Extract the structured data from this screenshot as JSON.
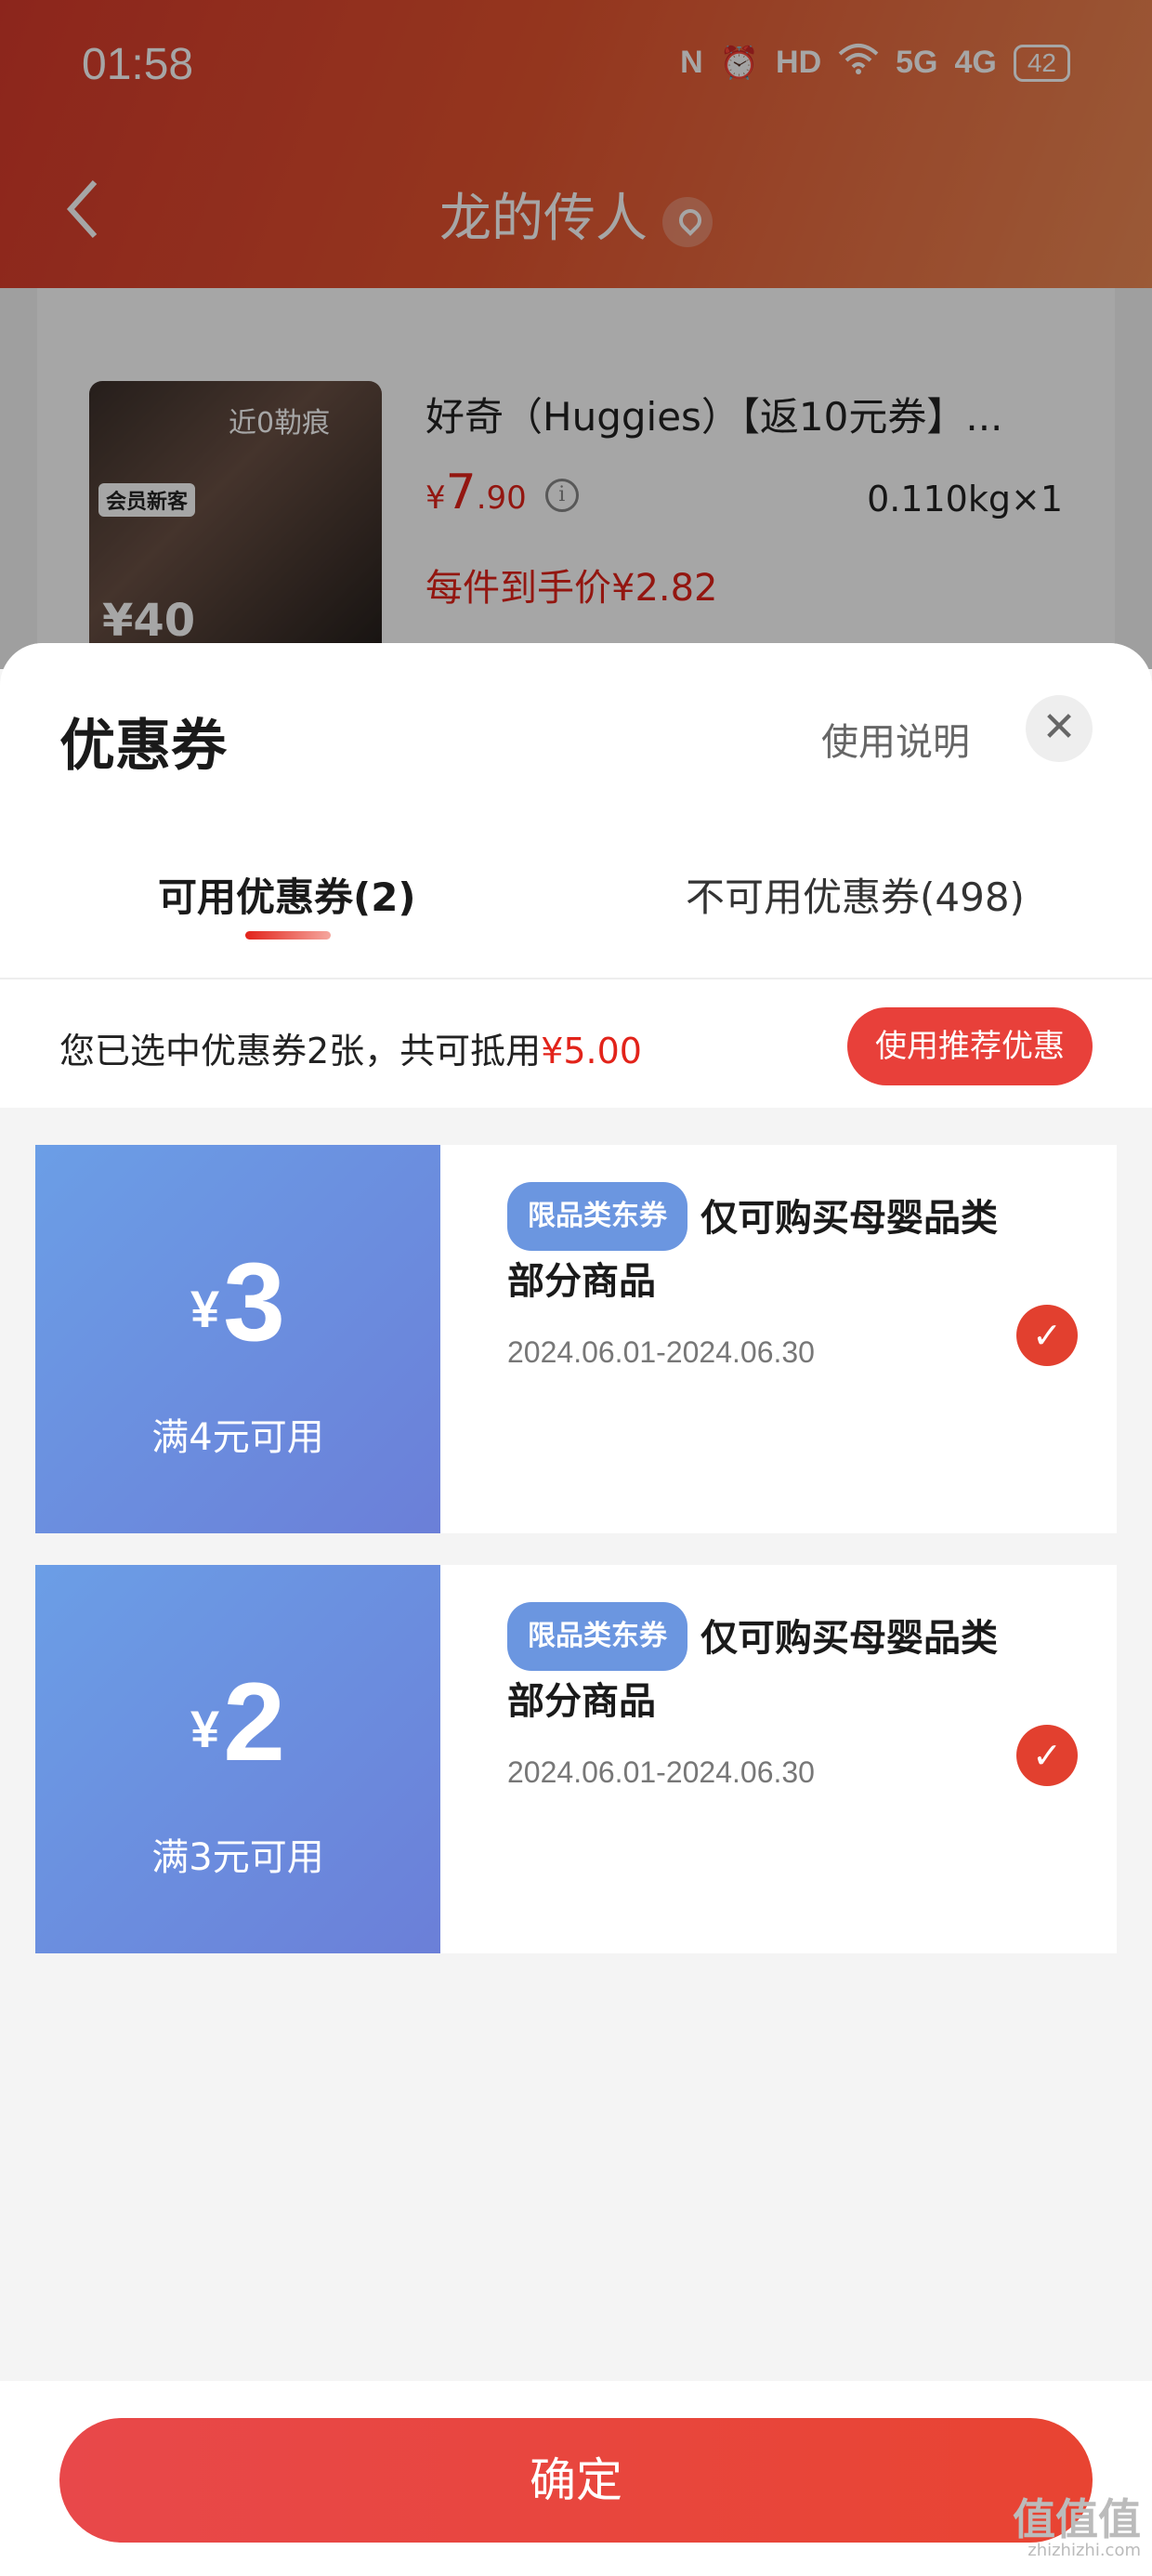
{
  "status_bar": {
    "time": "01:58",
    "icons": [
      "nfc-icon",
      "alarm-icon",
      "hd-icon",
      "wifi-icon",
      "signal-5g-icon",
      "signal-4g-icon"
    ],
    "nfc": "N",
    "hd": "HD",
    "net5g": "5G",
    "net4g": "4G",
    "battery": "42"
  },
  "nav": {
    "title": "龙的传人"
  },
  "product": {
    "image_num": "近0勒痕",
    "image_tag": "会员新客",
    "image_big": "¥40",
    "title": "好奇（Huggies）【返10元券】...",
    "price_symbol": "¥",
    "price_int": "7",
    "price_dec": ".90",
    "info_icon": "i",
    "weight": "0.110kg×1",
    "net_price": "每件到手价¥2.82"
  },
  "sheet": {
    "title": "优惠券",
    "help": "使用说明",
    "close_symbol": "✕",
    "tabs": [
      {
        "label": "可用优惠券(2)",
        "active": true
      },
      {
        "label": "不可用优惠券(498)",
        "active": false
      }
    ],
    "summary_text": "您已选中优惠券2张，共可抵用",
    "summary_amount": "¥5.00",
    "recommend_button": "使用推荐优惠"
  },
  "coupons": [
    {
      "currency": "¥",
      "amount": "3",
      "condition": "满4元可用",
      "tag": "限品类东券",
      "desc": "仅可购买母婴品类部分商品",
      "date": "2024.06.01-2024.06.30",
      "selected": true
    },
    {
      "currency": "¥",
      "amount": "2",
      "condition": "满3元可用",
      "tag": "限品类东券",
      "desc": "仅可购买母婴品类部分商品",
      "date": "2024.06.01-2024.06.30",
      "selected": true
    }
  ],
  "check_symbol": "✓",
  "confirm_button": "确定",
  "watermark": {
    "main": "值值值",
    "sub": "zhizhizhi.com"
  },
  "colors": {
    "accent": "#e2231a",
    "coupon_gradient_start": "#6b9ee6",
    "coupon_gradient_end": "#6b7fd8",
    "header_gradient_start": "#d83a2c"
  }
}
